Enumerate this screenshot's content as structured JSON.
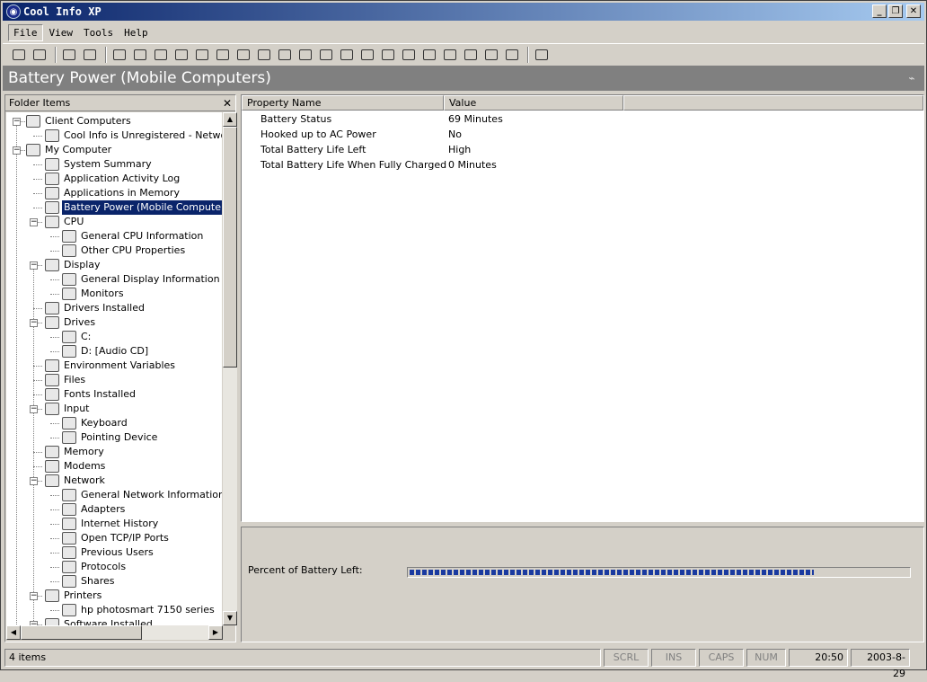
{
  "window": {
    "title": "Cool Info XP"
  },
  "menu": [
    "File",
    "View",
    "Tools",
    "Help"
  ],
  "toolbar_icons": [
    "printer-icon",
    "pointer-icon",
    "edit-icon",
    "properties-icon",
    "computer-icon",
    "app-log-icon",
    "memory-app-icon",
    "battery-icon",
    "cpu-icon",
    "display-icon",
    "drivers-icon",
    "drives-icon",
    "env-icon",
    "files-icon",
    "fonts-icon",
    "input-icon",
    "memory-icon",
    "modems-icon",
    "network-icon",
    "printers-icon",
    "software-icon",
    "sound-icon",
    "system-icon",
    "misc-icon",
    "help-icon"
  ],
  "header": {
    "title": "Battery Power (Mobile Computers)"
  },
  "left_panel": {
    "title": "Folder Items",
    "close": "✕"
  },
  "tree": [
    {
      "label": "Client Computers",
      "level": 0,
      "expander": "−",
      "icon": "network-computers-icon"
    },
    {
      "label": "Cool Info is Unregistered - Network View",
      "level": 1,
      "icon": "network-view-icon"
    },
    {
      "label": "My Computer",
      "level": 0,
      "expander": "−",
      "icon": "my-computer-icon"
    },
    {
      "label": "System Summary",
      "level": 1,
      "icon": "system-summary-icon"
    },
    {
      "label": "Application Activity Log",
      "level": 1,
      "icon": "app-log-icon"
    },
    {
      "label": "Applications in Memory",
      "level": 1,
      "icon": "apps-memory-icon"
    },
    {
      "label": "Battery Power (Mobile Computers)",
      "level": 1,
      "icon": "battery-icon",
      "selected": true
    },
    {
      "label": "CPU",
      "level": 1,
      "expander": "−",
      "icon": "cpu-icon"
    },
    {
      "label": "General CPU Information",
      "level": 2,
      "icon": "cpu-info-icon"
    },
    {
      "label": "Other CPU Properties",
      "level": 2,
      "icon": "cpu-props-icon"
    },
    {
      "label": "Display",
      "level": 1,
      "expander": "−",
      "icon": "display-icon"
    },
    {
      "label": "General Display Information",
      "level": 2,
      "icon": "display-info-icon"
    },
    {
      "label": "Monitors",
      "level": 2,
      "icon": "monitor-icon"
    },
    {
      "label": "Drivers Installed",
      "level": 1,
      "icon": "drivers-icon"
    },
    {
      "label": "Drives",
      "level": 1,
      "expander": "−",
      "icon": "drives-icon"
    },
    {
      "label": "C:",
      "level": 2,
      "icon": "hard-drive-icon"
    },
    {
      "label": "D: [Audio CD]",
      "level": 2,
      "icon": "cd-drive-icon"
    },
    {
      "label": "Environment Variables",
      "level": 1,
      "icon": "env-vars-icon"
    },
    {
      "label": "Files",
      "level": 1,
      "icon": "files-icon"
    },
    {
      "label": "Fonts Installed",
      "level": 1,
      "icon": "fonts-icon"
    },
    {
      "label": "Input",
      "level": 1,
      "expander": "−",
      "icon": "input-icon"
    },
    {
      "label": "Keyboard",
      "level": 2,
      "icon": "keyboard-icon"
    },
    {
      "label": "Pointing Device",
      "level": 2,
      "icon": "mouse-icon"
    },
    {
      "label": "Memory",
      "level": 1,
      "icon": "memory-icon"
    },
    {
      "label": "Modems",
      "level": 1,
      "icon": "modem-icon"
    },
    {
      "label": "Network",
      "level": 1,
      "expander": "−",
      "icon": "network-icon"
    },
    {
      "label": "General Network Information",
      "level": 2,
      "icon": "network-info-icon"
    },
    {
      "label": "Adapters",
      "level": 2,
      "icon": "adapter-icon"
    },
    {
      "label": "Internet History",
      "level": 2,
      "icon": "history-icon"
    },
    {
      "label": "Open TCP/IP Ports",
      "level": 2,
      "icon": "ports-icon"
    },
    {
      "label": "Previous Users",
      "level": 2,
      "icon": "users-icon"
    },
    {
      "label": "Protocols",
      "level": 2,
      "icon": "protocols-icon"
    },
    {
      "label": "Shares",
      "level": 2,
      "icon": "shares-icon"
    },
    {
      "label": "Printers",
      "level": 1,
      "expander": "−",
      "icon": "printers-icon"
    },
    {
      "label": "hp photosmart 7150 series",
      "level": 2,
      "icon": "printer-icon"
    },
    {
      "label": "Software Installed",
      "level": 1,
      "expander": "−",
      "icon": "software-icon"
    }
  ],
  "list": {
    "columns": [
      "Property Name",
      "Value"
    ],
    "rows": [
      [
        "Battery Status",
        "69 Minutes"
      ],
      [
        "Hooked up to AC Power",
        "No"
      ],
      [
        "Total Battery Life Left",
        "High"
      ],
      [
        "Total Battery Life When Fully Charged",
        "0 Minutes"
      ]
    ]
  },
  "battery": {
    "label": "Percent of Battery Left:",
    "percent": 81
  },
  "statusbar": {
    "items": "4 items",
    "scrl": "SCRL",
    "ins": "INS",
    "caps": "CAPS",
    "num": "NUM",
    "time": "20:50",
    "date": "2003-8-29"
  }
}
